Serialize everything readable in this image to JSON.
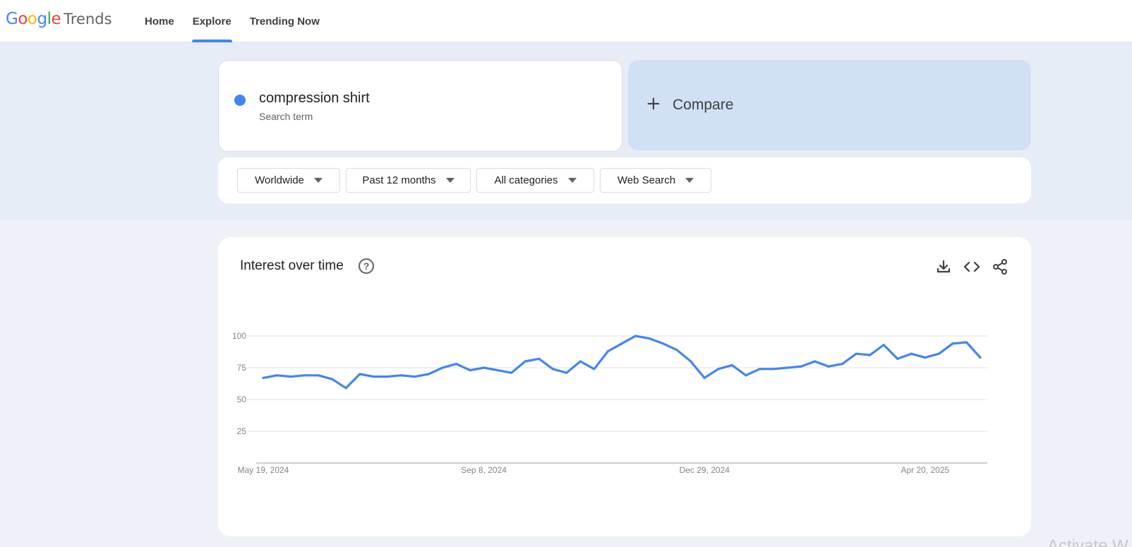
{
  "header": {
    "logo": {
      "google": "Google",
      "trends": "Trends"
    },
    "nav": [
      {
        "label": "Home"
      },
      {
        "label": "Explore"
      },
      {
        "label": "Trending Now"
      }
    ],
    "active_tab": "Explore"
  },
  "search": {
    "term": "compression shirt",
    "term_type": "Search term",
    "term_color": "#4285f4",
    "compare_label": "Compare"
  },
  "filters": [
    {
      "label": "Worldwide"
    },
    {
      "label": "Past 12 months"
    },
    {
      "label": "All categories"
    },
    {
      "label": "Web Search"
    }
  ],
  "interest_over_time": {
    "title": "Interest over time",
    "icons": [
      "help-icon",
      "download-icon",
      "embed-icon",
      "share-icon"
    ]
  },
  "chart_data": {
    "type": "line",
    "title": "Interest over time",
    "xlabel": "",
    "ylabel": "",
    "ylim": [
      0,
      100
    ],
    "yticks": [
      "100",
      "75",
      "50",
      "25"
    ],
    "xticks": [
      "May 19, 2024",
      "Sep 8, 2024",
      "Dec 29, 2024",
      "Apr 20, 2025"
    ],
    "grid": true,
    "legend": "none",
    "series": [
      {
        "color": "#4285f4",
        "x": [
          "May 19, 2024",
          "May 26, 2024",
          "Jun 2, 2024",
          "Jun 9, 2024",
          "Jun 16, 2024",
          "Jun 23, 2024",
          "Jun 30, 2024",
          "Jul 7, 2024",
          "Jul 14, 2024",
          "Jul 21, 2024",
          "Jul 28, 2024",
          "Aug 4, 2024",
          "Aug 11, 2024",
          "Aug 18, 2024",
          "Aug 25, 2024",
          "Sep 1, 2024",
          "Sep 8, 2024",
          "Sep 15, 2024",
          "Sep 22, 2024",
          "Sep 29, 2024",
          "Oct 6, 2024",
          "Oct 13, 2024",
          "Oct 20, 2024",
          "Oct 27, 2024",
          "Nov 3, 2024",
          "Nov 10, 2024",
          "Nov 17, 2024",
          "Nov 24, 2024",
          "Dec 1, 2024",
          "Dec 8, 2024",
          "Dec 15, 2024",
          "Dec 22, 2024",
          "Dec 29, 2024",
          "Jan 5, 2025",
          "Jan 12, 2025",
          "Jan 19, 2025",
          "Jan 26, 2025",
          "Feb 2, 2025",
          "Feb 9, 2025",
          "Feb 16, 2025",
          "Feb 23, 2025",
          "Mar 2, 2025",
          "Mar 9, 2025",
          "Mar 16, 2025",
          "Mar 23, 2025",
          "Mar 30, 2025",
          "Apr 6, 2025",
          "Apr 13, 2025",
          "Apr 20, 2025",
          "Apr 27, 2025",
          "May 4, 2025",
          "May 11, 2025",
          "May 18, 2025"
        ],
        "values": [
          67,
          69,
          68,
          69,
          69,
          66,
          59,
          70,
          68,
          68,
          69,
          68,
          70,
          75,
          78,
          73,
          75,
          73,
          71,
          80,
          82,
          74,
          71,
          80,
          74,
          88,
          94,
          100,
          98,
          94,
          89,
          80,
          67,
          74,
          77,
          69,
          74,
          74,
          75,
          76,
          80,
          76,
          78,
          86,
          85,
          93,
          82,
          86,
          83,
          86,
          94,
          95,
          83
        ]
      }
    ]
  }
}
